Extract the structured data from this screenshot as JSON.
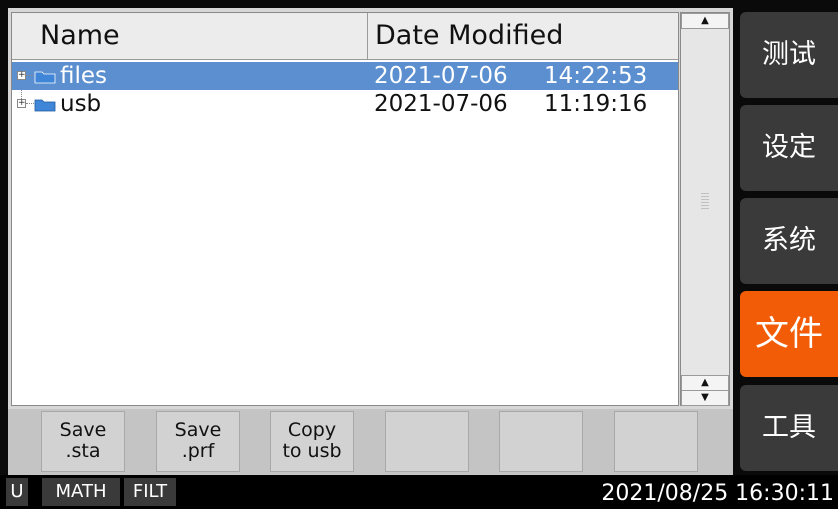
{
  "file_list": {
    "headers": {
      "name": "Name",
      "date_modified": "Date Modified"
    },
    "rows": [
      {
        "name": "files",
        "date": "2021-07-06",
        "time": "14:22:53",
        "selected": true
      },
      {
        "name": "usb",
        "date": "2021-07-06",
        "time": "11:19:16",
        "selected": false
      }
    ]
  },
  "softkeys": [
    {
      "line1": "Save",
      "line2": ".sta"
    },
    {
      "line1": "Save",
      "line2": ".prf"
    },
    {
      "line1": "Copy",
      "line2": "to usb"
    },
    {
      "line1": "",
      "line2": ""
    },
    {
      "line1": "",
      "line2": ""
    },
    {
      "line1": "",
      "line2": ""
    }
  ],
  "side_menu": [
    {
      "label": "测试",
      "active": false
    },
    {
      "label": "设定",
      "active": false
    },
    {
      "label": "系统",
      "active": false
    },
    {
      "label": "文件",
      "active": true
    },
    {
      "label": "工具",
      "active": false
    }
  ],
  "status_bar": {
    "tags": [
      "U",
      "MATH",
      "FILT"
    ],
    "datetime": "2021/08/25 16:30:11"
  },
  "colors": {
    "selection": "#5b8fd0",
    "active_menu": "#f25c06",
    "menu": "#3a3a3a",
    "folder": "#3f86d8"
  },
  "icons": [
    "folder-icon",
    "expand-icon",
    "scroll-up-icon",
    "scroll-down-icon"
  ]
}
